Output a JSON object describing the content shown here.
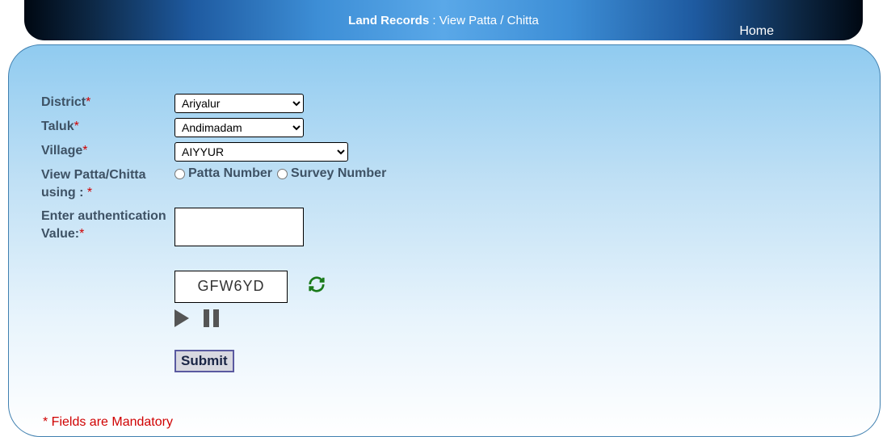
{
  "header": {
    "title_bold": "Land Records",
    "title_sep": " : ",
    "title_rest": "View Patta / Chitta",
    "home_link": "Home"
  },
  "form": {
    "district_label": "District",
    "district_value": "Ariyalur",
    "taluk_label": "Taluk",
    "taluk_value": "Andimadam",
    "village_label": "Village",
    "village_value": "AIYYUR",
    "view_using_label": "View Patta/Chitta using : ",
    "radio_patta": "Patta Number",
    "radio_survey": "Survey Number",
    "auth_label": "Enter authentication Value:",
    "auth_value": "",
    "captcha_text": "GFW6YD",
    "submit_label": "Submit",
    "mandatory_note": "* Fields are Mandatory"
  }
}
